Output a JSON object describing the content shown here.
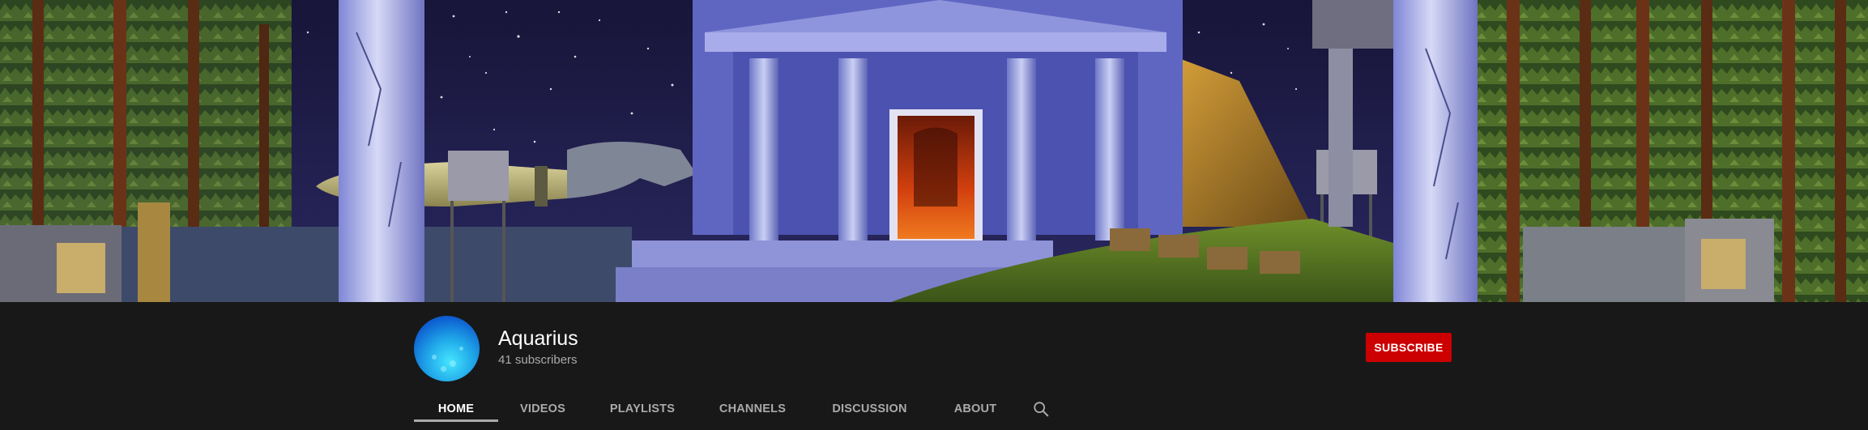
{
  "channel": {
    "name": "Aquarius",
    "subscribers": "41 subscribers",
    "subscribe_label": "SUBSCRIBE",
    "subscribe_color": "#cc0000"
  },
  "tabs": [
    {
      "label": "HOME",
      "active": true
    },
    {
      "label": "VIDEOS",
      "active": false
    },
    {
      "label": "PLAYLISTS",
      "active": false
    },
    {
      "label": "CHANNELS",
      "active": false
    },
    {
      "label": "DISCUSSION",
      "active": false
    },
    {
      "label": "ABOUT",
      "active": false
    }
  ],
  "search": {
    "icon": "search-icon"
  },
  "banner": {
    "description_icon": "temple-night-scene"
  },
  "colors": {
    "background": "#181818",
    "text_primary": "#ffffff",
    "text_secondary": "#aaaaaa"
  }
}
